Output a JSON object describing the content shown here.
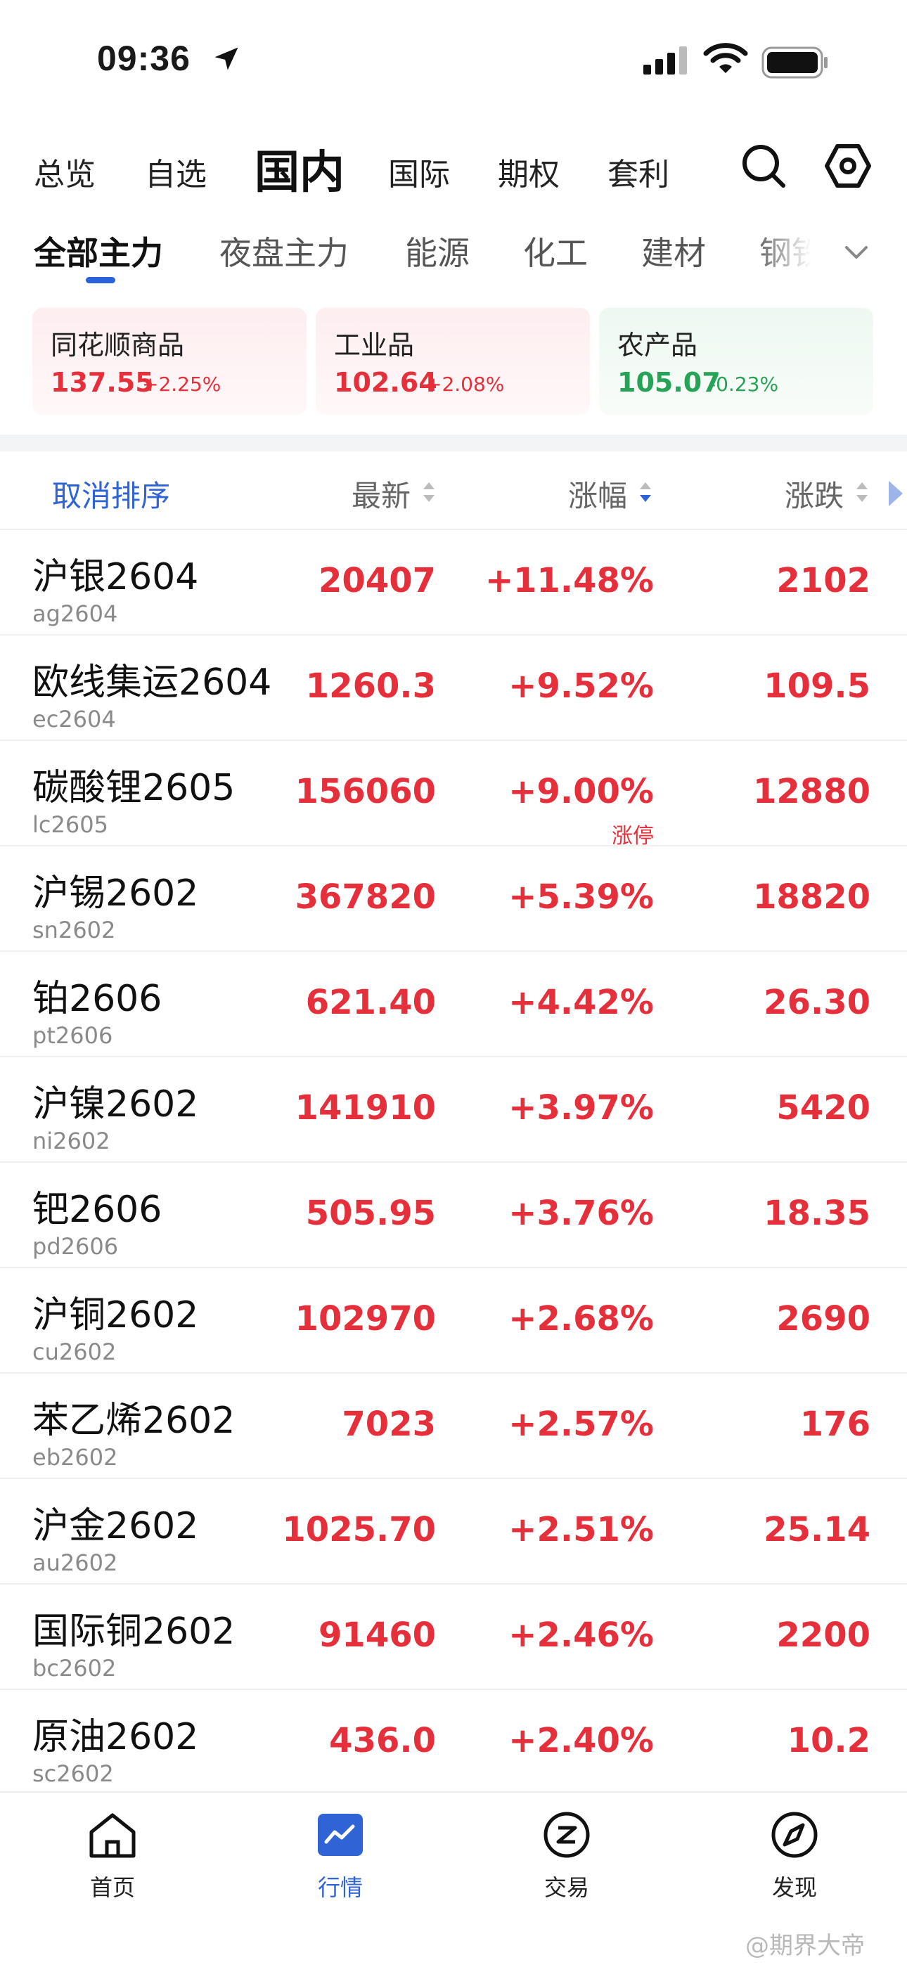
{
  "status": {
    "time": "09:36"
  },
  "top_tabs": [
    "总览",
    "自选",
    "国内",
    "国际",
    "期权",
    "套利"
  ],
  "sub_tabs": [
    "全部主力",
    "夜盘主力",
    "能源",
    "化工",
    "建材",
    "钢铁"
  ],
  "index_cards": [
    {
      "name": "同花顺商品",
      "value": "137.55",
      "pct": "+2.25%",
      "dir": "up"
    },
    {
      "name": "工业品",
      "value": "102.64",
      "pct": "+2.08%",
      "dir": "up"
    },
    {
      "name": "农产品",
      "value": "105.07",
      "pct": "-0.23%",
      "dir": "down"
    }
  ],
  "table": {
    "cancel_sort": "取消排序",
    "columns": {
      "price": "最新",
      "pct": "涨幅",
      "change": "涨跌"
    },
    "rows": [
      {
        "name": "沪银2604",
        "code": "ag2604",
        "price": "20407",
        "pct": "+11.48%",
        "change": "2102"
      },
      {
        "name": "欧线集运2604",
        "code": "ec2604",
        "price": "1260.3",
        "pct": "+9.52%",
        "change": "109.5"
      },
      {
        "name": "碳酸锂2605",
        "code": "lc2605",
        "price": "156060",
        "pct": "+9.00%",
        "change": "12880",
        "tag": "涨停"
      },
      {
        "name": "沪锡2602",
        "code": "sn2602",
        "price": "367820",
        "pct": "+5.39%",
        "change": "18820"
      },
      {
        "name": "铂2606",
        "code": "pt2606",
        "price": "621.40",
        "pct": "+4.42%",
        "change": "26.30"
      },
      {
        "name": "沪镍2602",
        "code": "ni2602",
        "price": "141910",
        "pct": "+3.97%",
        "change": "5420"
      },
      {
        "name": "钯2606",
        "code": "pd2606",
        "price": "505.95",
        "pct": "+3.76%",
        "change": "18.35"
      },
      {
        "name": "沪铜2602",
        "code": "cu2602",
        "price": "102970",
        "pct": "+2.68%",
        "change": "2690"
      },
      {
        "name": "苯乙烯2602",
        "code": "eb2602",
        "price": "7023",
        "pct": "+2.57%",
        "change": "176"
      },
      {
        "name": "沪金2602",
        "code": "au2602",
        "price": "1025.70",
        "pct": "+2.51%",
        "change": "25.14"
      },
      {
        "name": "国际铜2602",
        "code": "bc2602",
        "price": "91460",
        "pct": "+2.46%",
        "change": "2200"
      },
      {
        "name": "原油2602",
        "code": "sc2602",
        "price": "436.0",
        "pct": "+2.40%",
        "change": "10.2"
      }
    ]
  },
  "bottom_nav": [
    "首页",
    "行情",
    "交易",
    "发现"
  ],
  "watermark": "@期界大帝",
  "colors": {
    "up": "#e5303b",
    "down": "#26a356",
    "accent": "#2f63d6"
  }
}
